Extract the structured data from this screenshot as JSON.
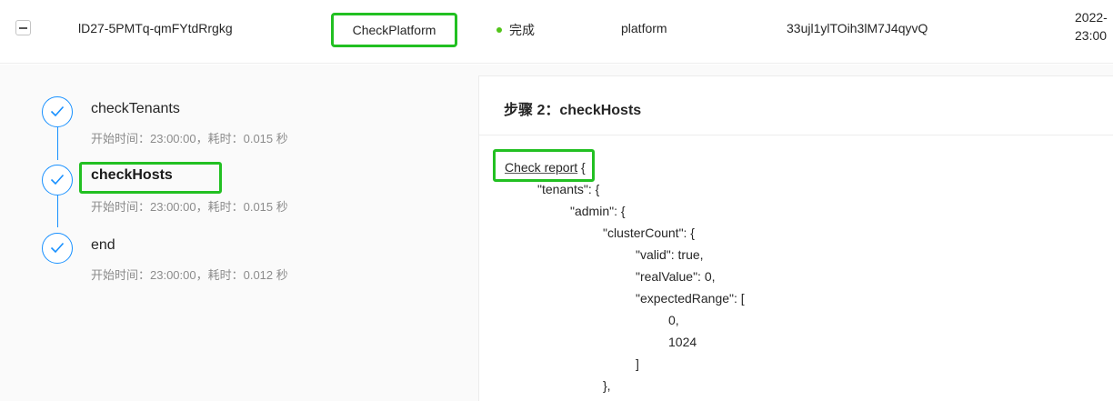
{
  "row": {
    "id": "lD27-5PMTq-qmFYtdRrgkg",
    "name": "CheckPlatform",
    "status": "完成",
    "type": "platform",
    "trace_id": "33ujl1ylTOih3lM7J4qyvQ",
    "time_line1": "2022-",
    "time_line2": "23:00"
  },
  "steps": [
    {
      "title": "checkTenants",
      "desc": "开始时间：23:00:00，耗时：0.015 秒"
    },
    {
      "title": "checkHosts",
      "desc": "开始时间：23:00:00，耗时：0.015 秒"
    },
    {
      "title": "end",
      "desc": "开始时间：23:00:00，耗时：0.012 秒"
    }
  ],
  "detail": {
    "title": "步骤 2：checkHosts",
    "report_label": "Check report",
    "lines": [
      " {",
      "\"tenants\": {",
      "\"admin\": {",
      "\"clusterCount\": {",
      "\"valid\": true,",
      "\"realValue\": 0,",
      "\"expectedRange\": [",
      "0,",
      "1024",
      "]",
      "},"
    ]
  },
  "colors": {
    "accent": "#1890ff",
    "highlight": "#22c022",
    "status_ok": "#52c41a"
  }
}
